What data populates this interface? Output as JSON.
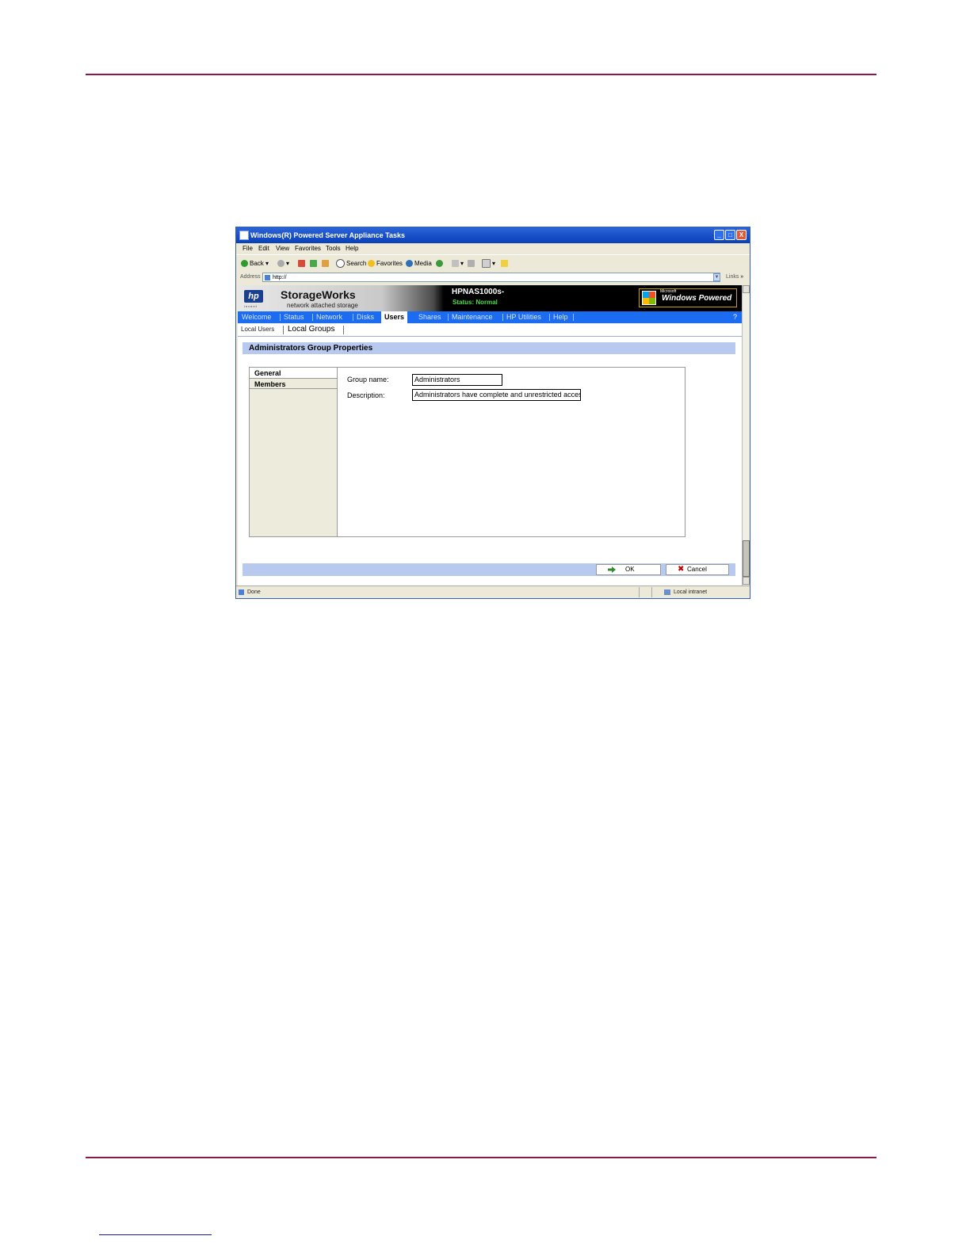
{
  "window": {
    "title": "Windows(R) Powered Server Appliance Tasks",
    "controls": {
      "minimize": "_",
      "maximize": "□",
      "close": "X"
    }
  },
  "menu": [
    "File",
    "Edit",
    "View",
    "Favorites",
    "Tools",
    "Help"
  ],
  "toolbar": {
    "back": "Back",
    "search": "Search",
    "favorites": "Favorites",
    "media": "Media"
  },
  "address": {
    "label": "Address",
    "value": "http://",
    "links": "Links",
    "more": "»"
  },
  "banner": {
    "brand": "StorageWorks",
    "brand_sub": "network attached storage",
    "hp_logo": "hp",
    "hp_tagline": "invent",
    "server": "HPNAS1000s-",
    "status": "Status: Normal",
    "ms_label": "Microsoft",
    "windows_badge": "Windows Powered"
  },
  "nav": {
    "items": [
      "Welcome",
      "Status",
      "Network",
      "Disks",
      "Users",
      "Shares",
      "Maintenance",
      "HP Utilities",
      "Help"
    ],
    "active": "Users",
    "help_icon": "?"
  },
  "subnav": {
    "tabs": [
      "Local Users",
      "Local Groups"
    ],
    "active": "Local Groups"
  },
  "page_title": "Administrators Group Properties",
  "sidebar_tabs": [
    "General",
    "Members"
  ],
  "form": {
    "group_name_label": "Group name:",
    "group_name_value": "Administrators",
    "description_label": "Description:",
    "description_value": "Administrators have complete and unrestricted access to the computer/domain"
  },
  "buttons": {
    "ok": "OK",
    "cancel": "Cancel"
  },
  "status_bar": {
    "left": "Done",
    "zone": "Local intranet"
  },
  "colors": {
    "page_rule": "#8b1a4a",
    "nav_bar": "#1c6cf2",
    "section_bar": "#b7c9ee",
    "server_status": "#4cdc4c"
  }
}
